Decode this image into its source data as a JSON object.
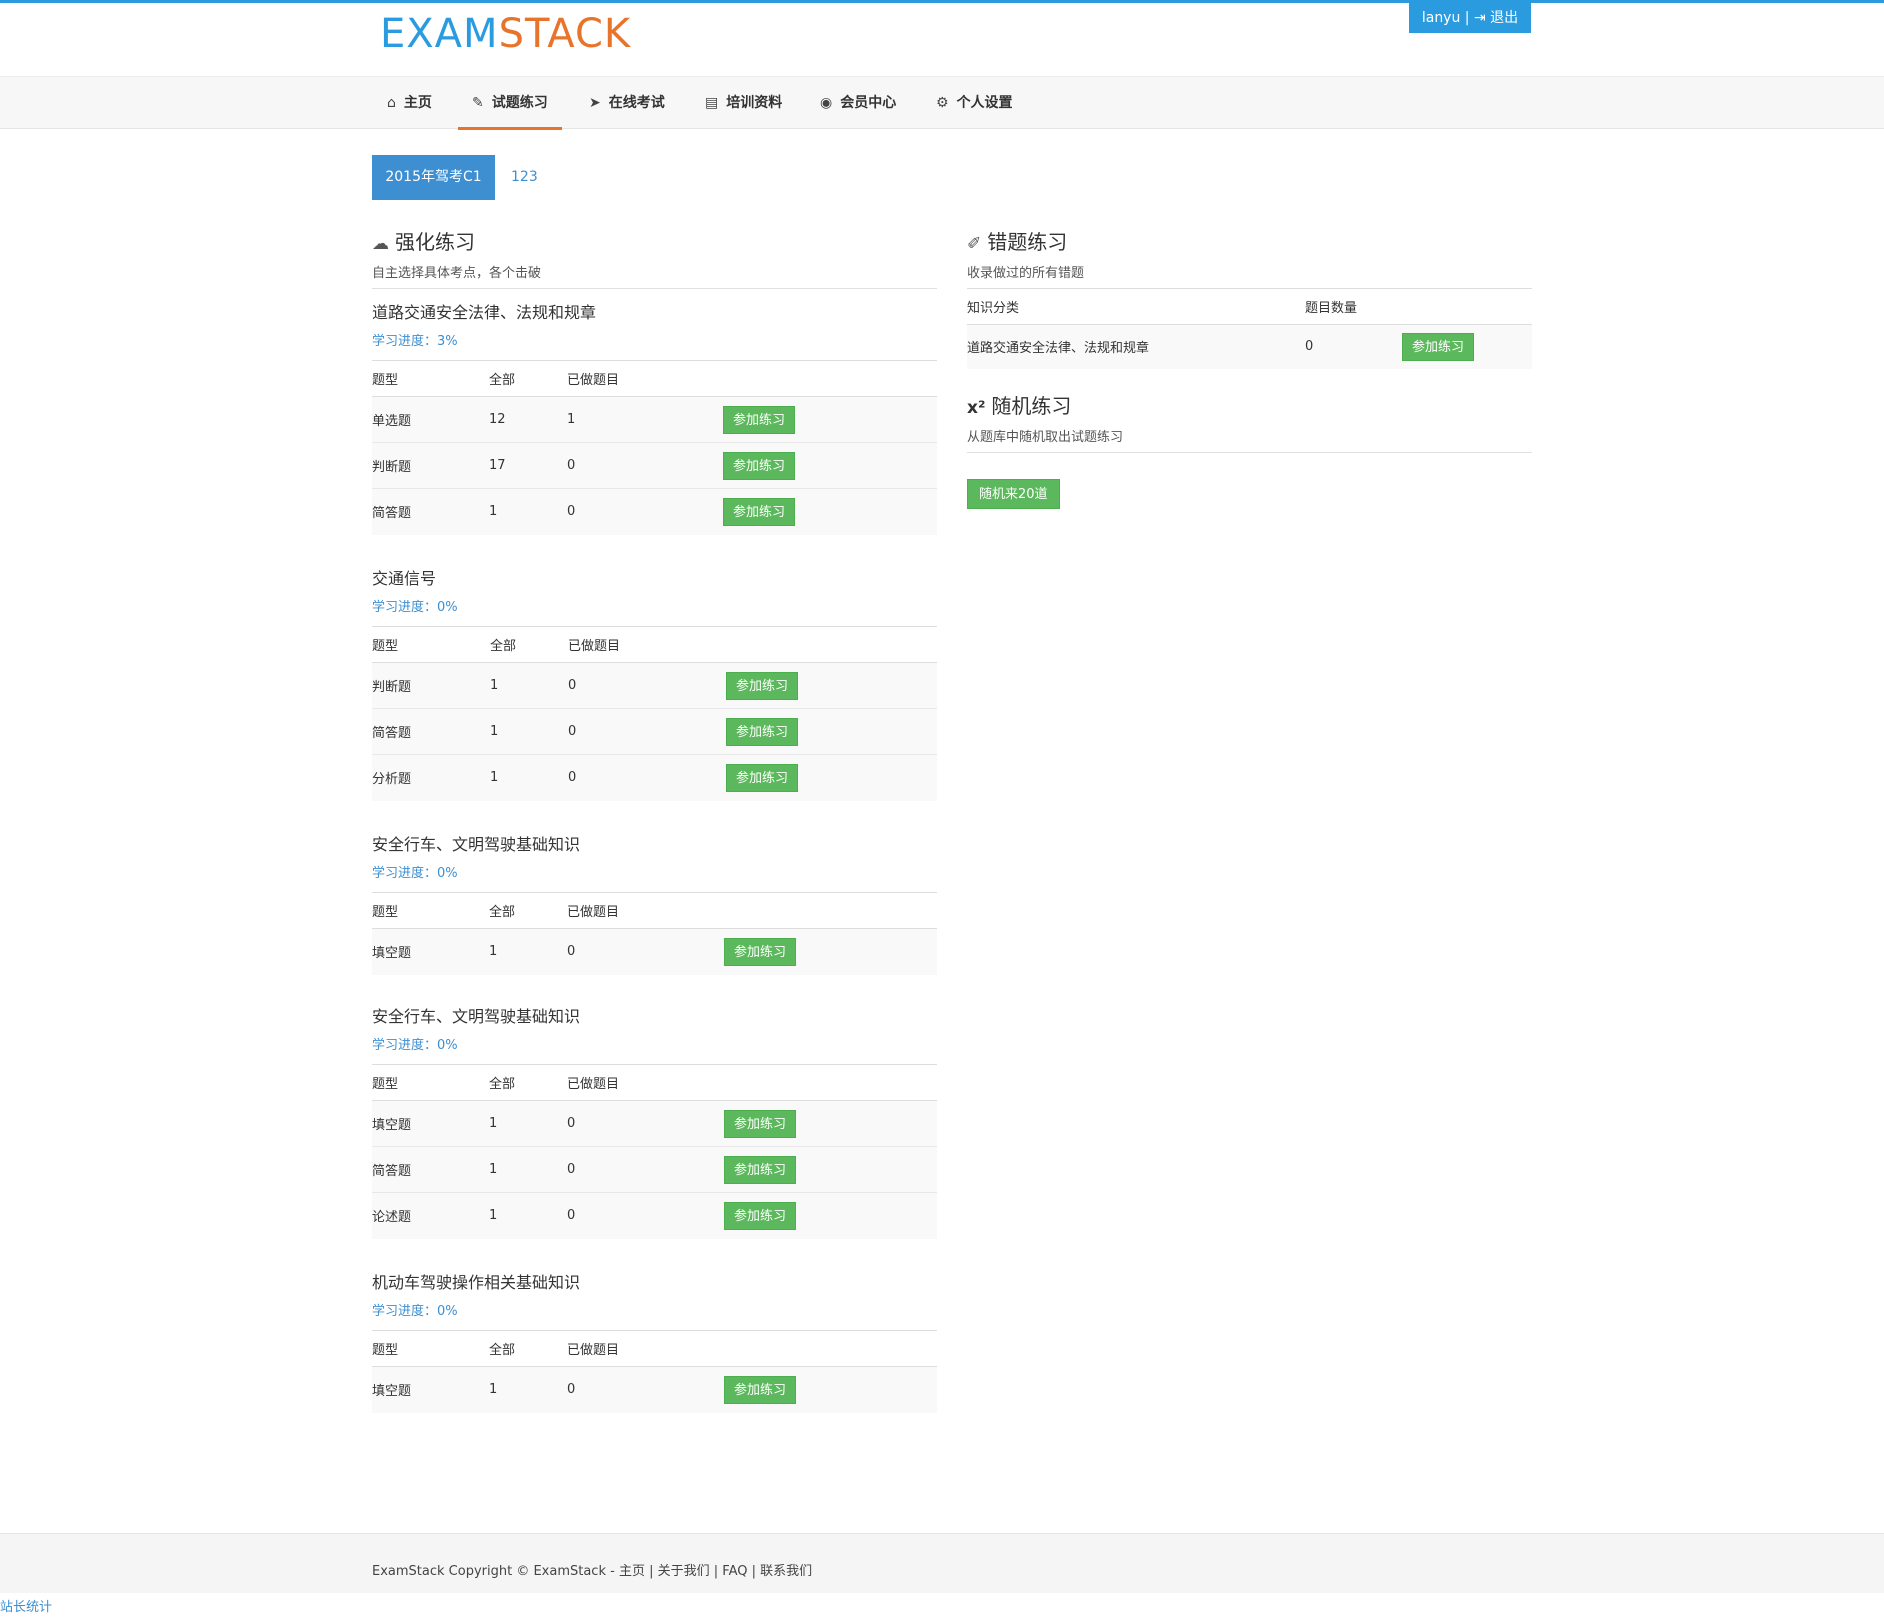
{
  "brand": {
    "logo_part1": "EXAM",
    "logo_part2": "STACK"
  },
  "user": {
    "name": "lanyu",
    "separator": " | ",
    "logout_icon": "sign-out-icon",
    "logout_label": "退出"
  },
  "nav": {
    "items": [
      {
        "label": "主页",
        "icon": "home-icon",
        "glyph": "⌂"
      },
      {
        "label": "试题练习",
        "icon": "edit-icon",
        "glyph": "✎"
      },
      {
        "label": "在线考试",
        "icon": "paper-plane-icon",
        "glyph": "➤"
      },
      {
        "label": "培训资料",
        "icon": "book-icon",
        "glyph": "▤"
      },
      {
        "label": "会员中心",
        "icon": "dashboard-icon",
        "glyph": "◉"
      },
      {
        "label": "个人设置",
        "icon": "cogs-icon",
        "glyph": "⚙"
      }
    ],
    "active_index": 1
  },
  "tabs": {
    "active": "2015年驾考C1",
    "other": "123"
  },
  "practice": {
    "title": "强化练习",
    "icon": "cloud-upload-icon",
    "desc": "自主选择具体考点，各个击破",
    "headers": {
      "type": "题型",
      "total": "全部",
      "done": "已做题目"
    },
    "button_label": "参加练习",
    "groups": [
      {
        "title": "道路交通安全法律、法规和规章",
        "progress": "学习进度：3%",
        "rows": [
          {
            "type": "单选题",
            "total": "12",
            "done": "1"
          },
          {
            "type": "判断题",
            "total": "17",
            "done": "0"
          },
          {
            "type": "简答题",
            "total": "1",
            "done": "0"
          }
        ]
      },
      {
        "title": "交通信号",
        "progress": "学习进度：0%",
        "rows": [
          {
            "type": "判断题",
            "total": "1",
            "done": "0"
          },
          {
            "type": "简答题",
            "total": "1",
            "done": "0"
          },
          {
            "type": "分析题",
            "total": "1",
            "done": "0"
          }
        ]
      },
      {
        "title": "安全行车、文明驾驶基础知识",
        "progress": "学习进度：0%",
        "rows": [
          {
            "type": "填空题",
            "total": "1",
            "done": "0"
          }
        ]
      },
      {
        "title": "安全行车、文明驾驶基础知识",
        "progress": "学习进度：0%",
        "rows": [
          {
            "type": "填空题",
            "total": "1",
            "done": "0"
          },
          {
            "type": "简答题",
            "total": "1",
            "done": "0"
          },
          {
            "type": "论述题",
            "total": "1",
            "done": "0"
          }
        ]
      },
      {
        "title": "机动车驾驶操作相关基础知识",
        "progress": "学习进度：0%",
        "rows": [
          {
            "type": "填空题",
            "total": "1",
            "done": "0"
          }
        ]
      }
    ]
  },
  "wrong": {
    "title": "错题练习",
    "icon": "eraser-icon",
    "desc": "收录做过的所有错题",
    "headers": {
      "category": "知识分类",
      "count": "题目数量"
    },
    "rows": [
      {
        "category": "道路交通安全法律、法规和规章",
        "count": "0",
        "button": "参加练习"
      }
    ]
  },
  "random": {
    "title": "随机练习",
    "icon": "superscript-icon",
    "desc": "从题库中随机取出试题练习",
    "button": "随机来20道"
  },
  "footer": {
    "copyright": "ExamStack Copyright © ExamStack - ",
    "links": [
      "主页",
      "关于我们",
      "FAQ",
      "联系我们"
    ],
    "separator": " | ",
    "stat": "站长统计"
  }
}
